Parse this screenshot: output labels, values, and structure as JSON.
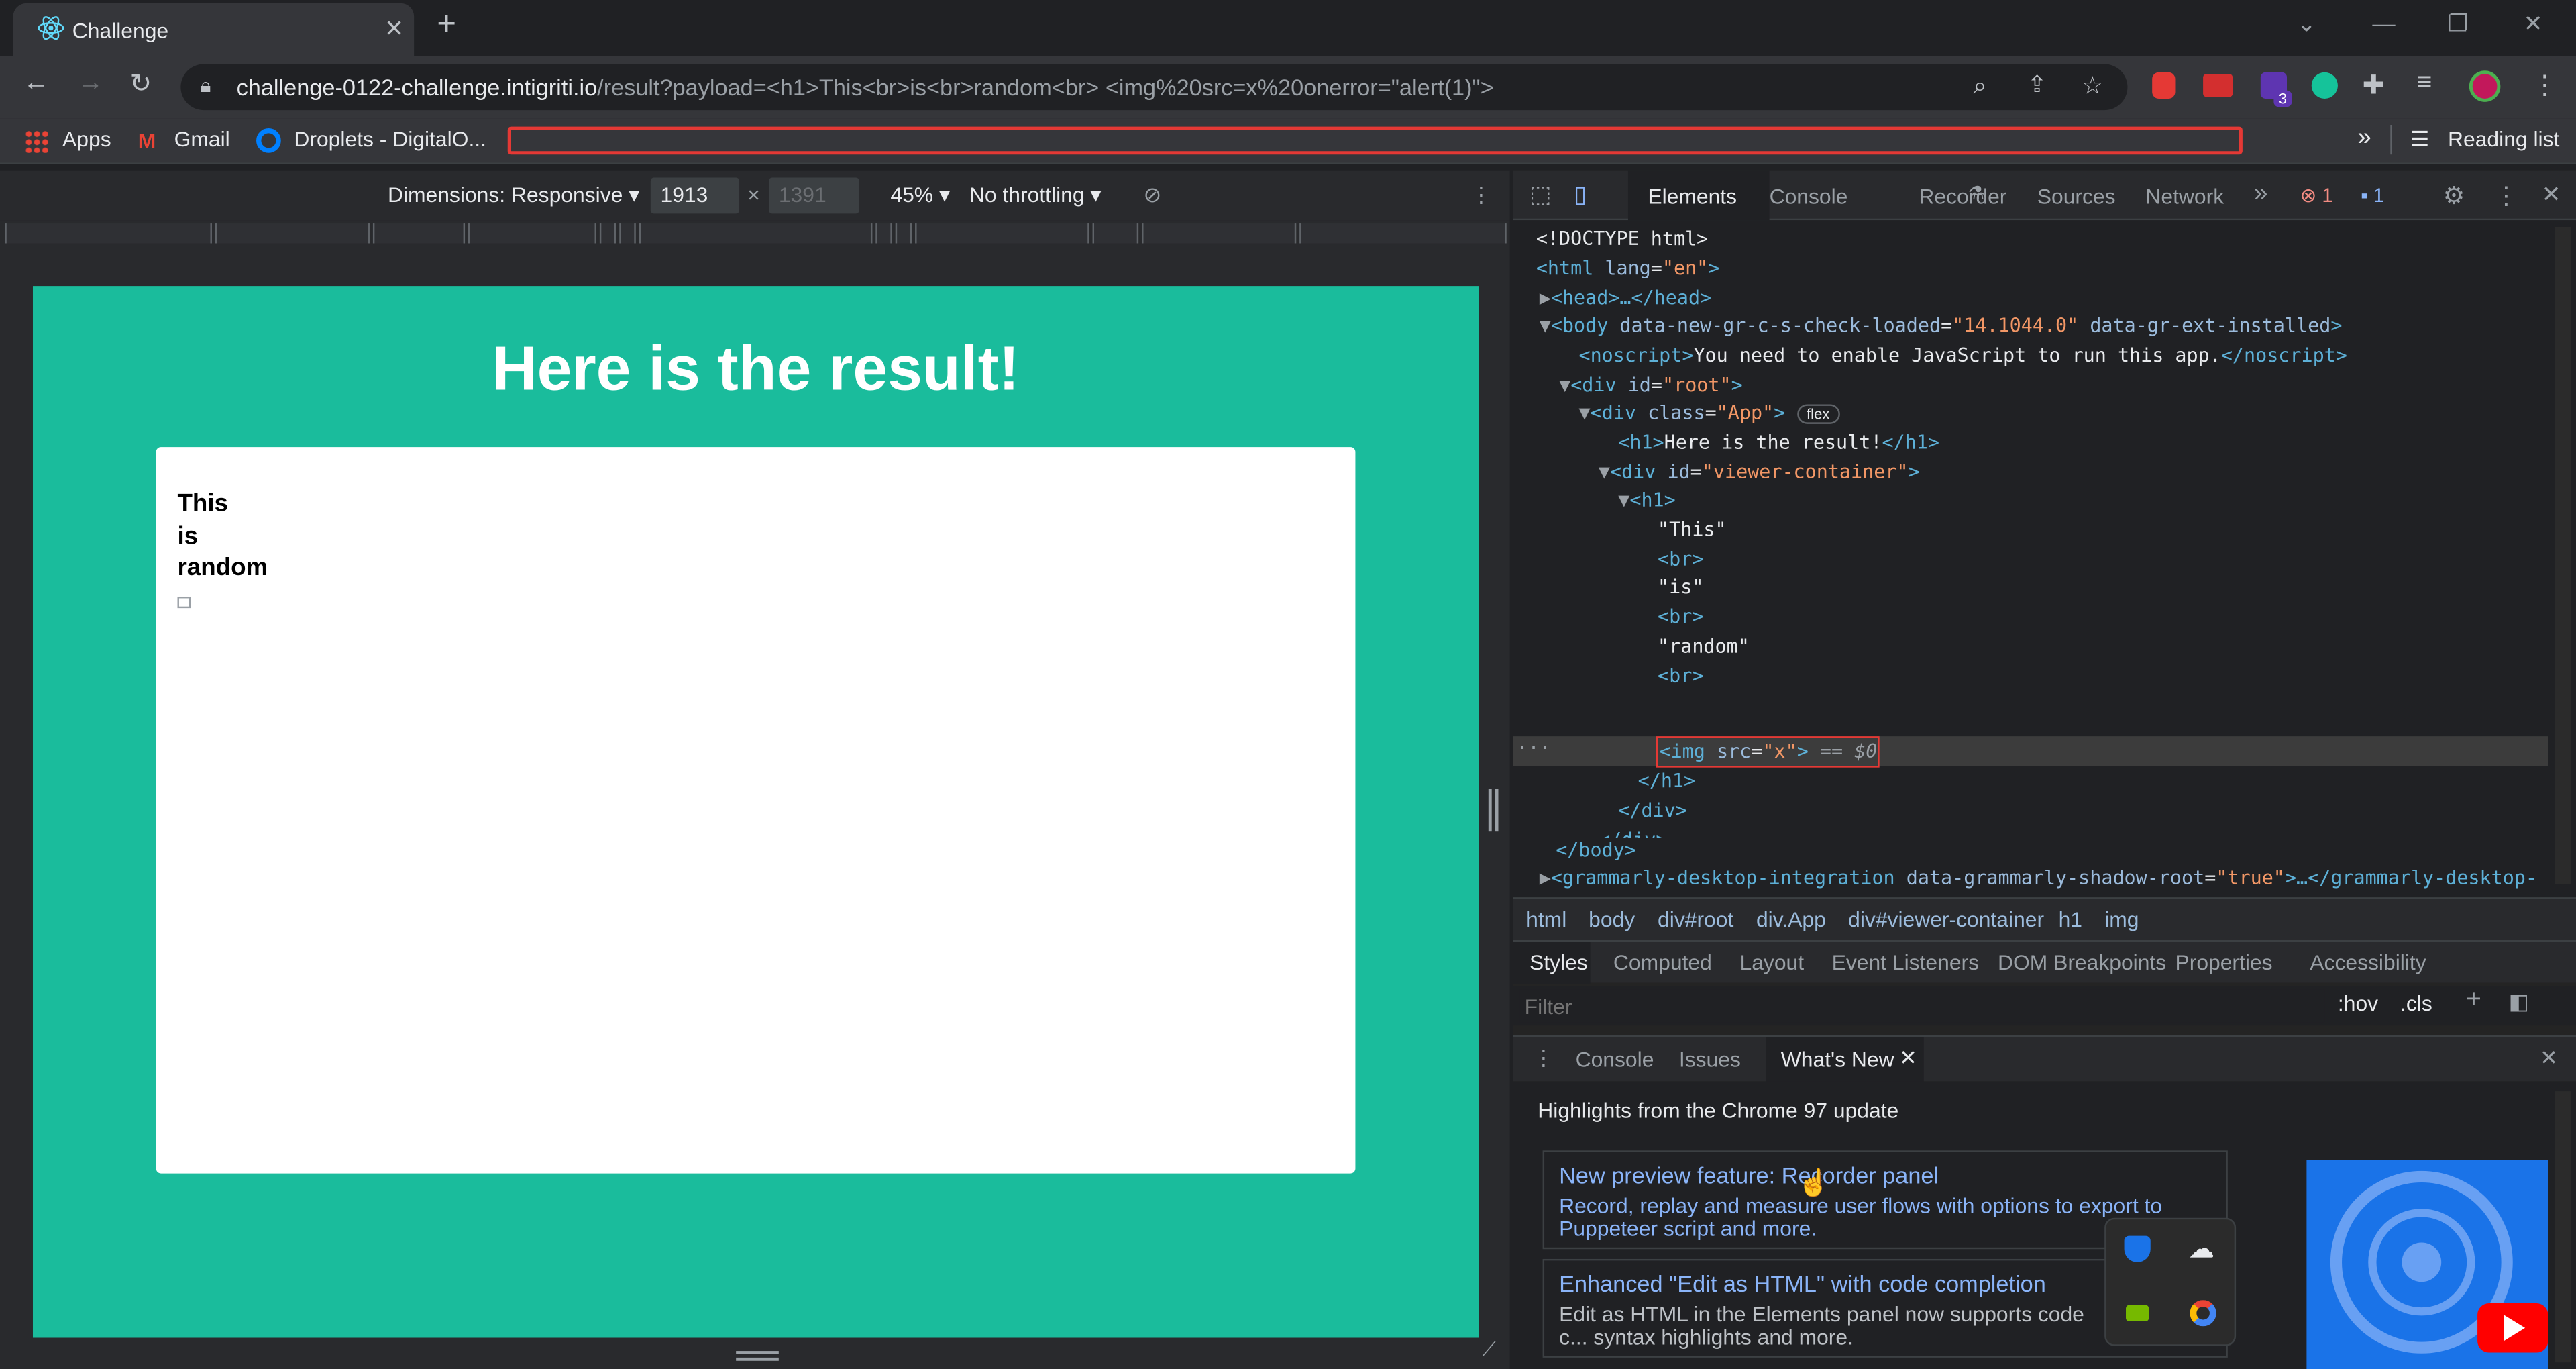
{
  "browser": {
    "tab_title": "Challenge",
    "tab_close": "✕",
    "new_tab": "+",
    "url_host": "challenge-0122-challenge.intigriti.io",
    "url_path": "/result?payload=<h1>This<br>is<br>random<br> <img%20src=x%20onerror=\"alert(1)\">",
    "bookmarks": [
      "Apps",
      "Gmail",
      "Droplets - DigitalO..."
    ],
    "more": "»",
    "reading_list": "Reading list",
    "ext_badge": "3"
  },
  "device_toolbar": {
    "dimensions": "Dimensions: Responsive",
    "width": "1913",
    "times": "×",
    "height": "1391",
    "zoom": "45%",
    "throttle": "No throttling"
  },
  "page": {
    "title": "Here is the result!",
    "lines": [
      "This",
      "is",
      "random"
    ],
    "bg_color": "#1abc9c"
  },
  "devtools": {
    "tabs": [
      "Elements",
      "Console",
      "Recorder",
      "Sources",
      "Network"
    ],
    "more_tabs": "»",
    "error_count": "1",
    "message_count": "1",
    "dom": {
      "doctype": "<!DOCTYPE html>",
      "html_open": "<html",
      "html_lang_attr": "lang",
      "html_lang_val": "\"en\"",
      "head": "<head>…</head>",
      "body_open": "<body",
      "body_attr1": "data-new-gr-c-s-check-loaded",
      "body_val1": "\"14.1044.0\"",
      "body_attr2": "data-gr-ext-installed",
      "noscript_open": "<noscript>",
      "noscript_text": "You need to enable JavaScript to run this app.",
      "noscript_close": "</noscript>",
      "div_root": "<div",
      "id_attr": "id",
      "root_val": "\"root\"",
      "class_attr": "class",
      "app_val": "\"App\"",
      "flex_badge": "flex",
      "h1_title_open": "<h1>",
      "h1_title_text": "Here is the result!",
      "h1_close": "</h1>",
      "viewer_val": "\"viewer-container\"",
      "h1_open": "<h1>",
      "text_this": "\"This\"",
      "br": "<br>",
      "text_is": "\"is\"",
      "text_random": "\"random\"",
      "img_open": "<img",
      "src_attr": "src",
      "src_val": "\"x\"",
      "sel_marker": "== $0",
      "div_close": "</div>",
      "body_close": "</body>",
      "grammarly_open": "<grammarly-desktop-integration",
      "grammarly_attr": "data-grammarly-shadow-root",
      "grammarly_val": "\"true\"",
      "grammarly_close": ">…</grammarly-desktop-"
    },
    "breadcrumbs": [
      "html",
      "body",
      "div#root",
      "div.App",
      "div#viewer-container",
      "h1",
      "img"
    ],
    "styles_tabs": [
      "Styles",
      "Computed",
      "Layout",
      "Event Listeners",
      "DOM Breakpoints",
      "Properties",
      "Accessibility"
    ],
    "filter_placeholder": "Filter",
    "hov": ":hov",
    "cls": ".cls",
    "drawer_tabs": [
      "Console",
      "Issues",
      "What's New"
    ],
    "whats_new": {
      "heading": "Highlights from the Chrome 97 update",
      "item1_title": "New preview feature: Recorder panel",
      "item1_desc": "Record, replay and measure user flows with options to export to Puppeteer script and more.",
      "item2_title": "Enhanced \"Edit as HTML\" with code completion",
      "item2_desc": "Edit as HTML in the Elements panel now supports code c... syntax highlights and more."
    }
  }
}
